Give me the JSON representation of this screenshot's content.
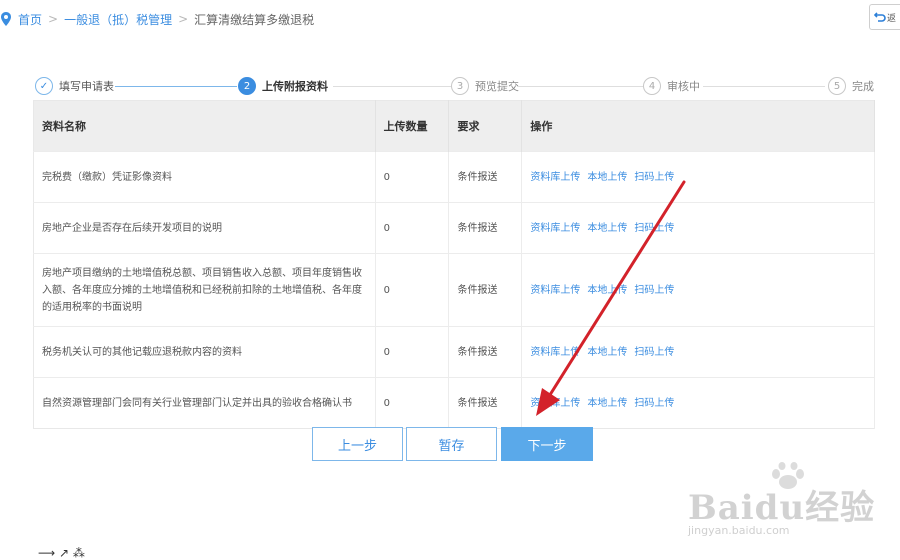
{
  "breadcrumb": {
    "home": "首页",
    "level2": "一般退（抵）税管理",
    "current": "汇算清缴结算多缴退税",
    "sep": ">"
  },
  "back_button": {
    "label": "返"
  },
  "stepper": {
    "steps": [
      {
        "num": "✓",
        "label": "填写申请表",
        "state": "done"
      },
      {
        "num": "2",
        "label": "上传附报资料",
        "state": "active"
      },
      {
        "num": "3",
        "label": "预览提交",
        "state": "todo"
      },
      {
        "num": "4",
        "label": "审核中",
        "state": "todo"
      },
      {
        "num": "5",
        "label": "完成",
        "state": "todo"
      }
    ]
  },
  "table": {
    "headers": [
      "资料名称",
      "上传数量",
      "要求",
      "操作"
    ],
    "rows": [
      {
        "name": "完税费（缴款）凭证影像资料",
        "count": "0",
        "requirement": "条件报送"
      },
      {
        "name": "房地产企业是否存在后续开发项目的说明",
        "count": "0",
        "requirement": "条件报送"
      },
      {
        "name": "房地产项目缴纳的土地增值税总额、项目销售收入总额、项目年度销售收入额、各年度应分摊的土地增值税和已经税前扣除的土地增值税、各年度的适用税率的书面说明",
        "count": "0",
        "requirement": "条件报送"
      },
      {
        "name": "税务机关认可的其他记载应退税款内容的资料",
        "count": "0",
        "requirement": "条件报送"
      },
      {
        "name": "自然资源管理部门会同有关行业管理部门认定并出具的验收合格确认书",
        "count": "0",
        "requirement": "条件报送"
      }
    ],
    "ops": [
      "资料库上传",
      "本地上传",
      "扫码上传"
    ]
  },
  "buttons": {
    "prev": "上一步",
    "save": "暂存",
    "next": "下一步"
  },
  "watermark": {
    "brand": "Baidu经验",
    "url": "jingyan.baidu.com"
  },
  "bottom": {
    "text": "⟶ ↗ ⁂"
  },
  "colors": {
    "accent": "#3b8de0",
    "arrow": "#d3222a",
    "primary_btn": "#5aa9ea"
  }
}
